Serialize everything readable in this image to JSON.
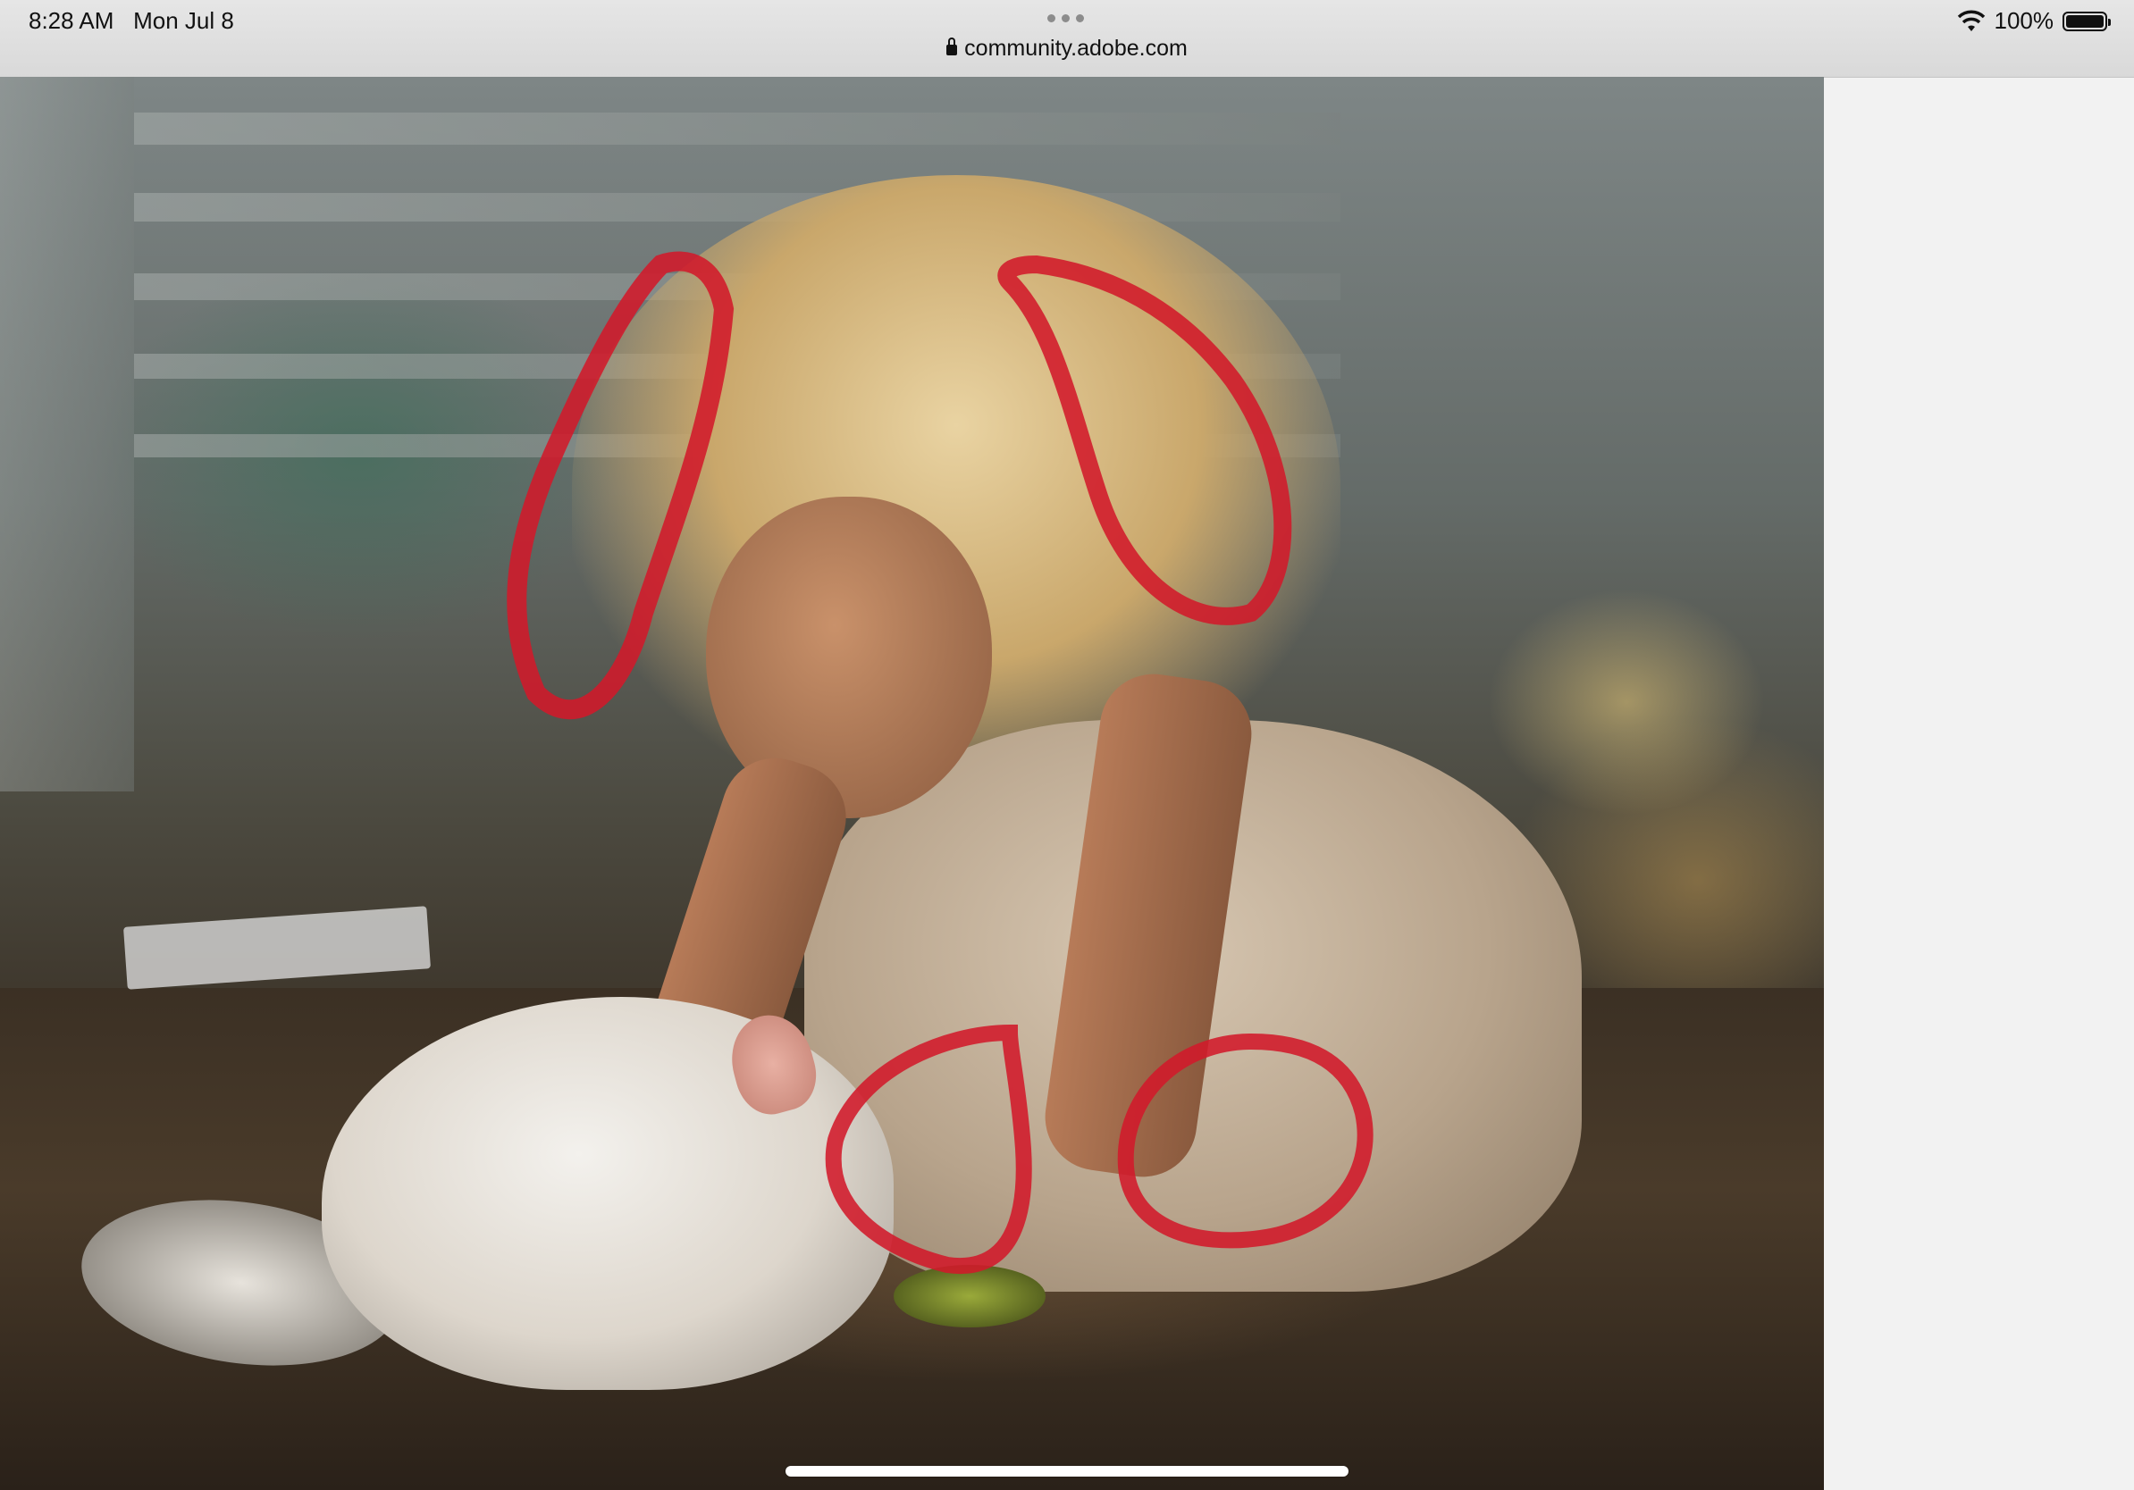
{
  "status_bar": {
    "time": "8:28 AM",
    "date": "Mon Jul 8",
    "url": "community.adobe.com",
    "battery_percent": "100%",
    "battery_level": 1.0
  },
  "photo": {
    "annotation_color": "#d2192a",
    "annotations": [
      "left-hair-outline",
      "right-hair-outline",
      "hand-circle",
      "knee-circle"
    ]
  }
}
